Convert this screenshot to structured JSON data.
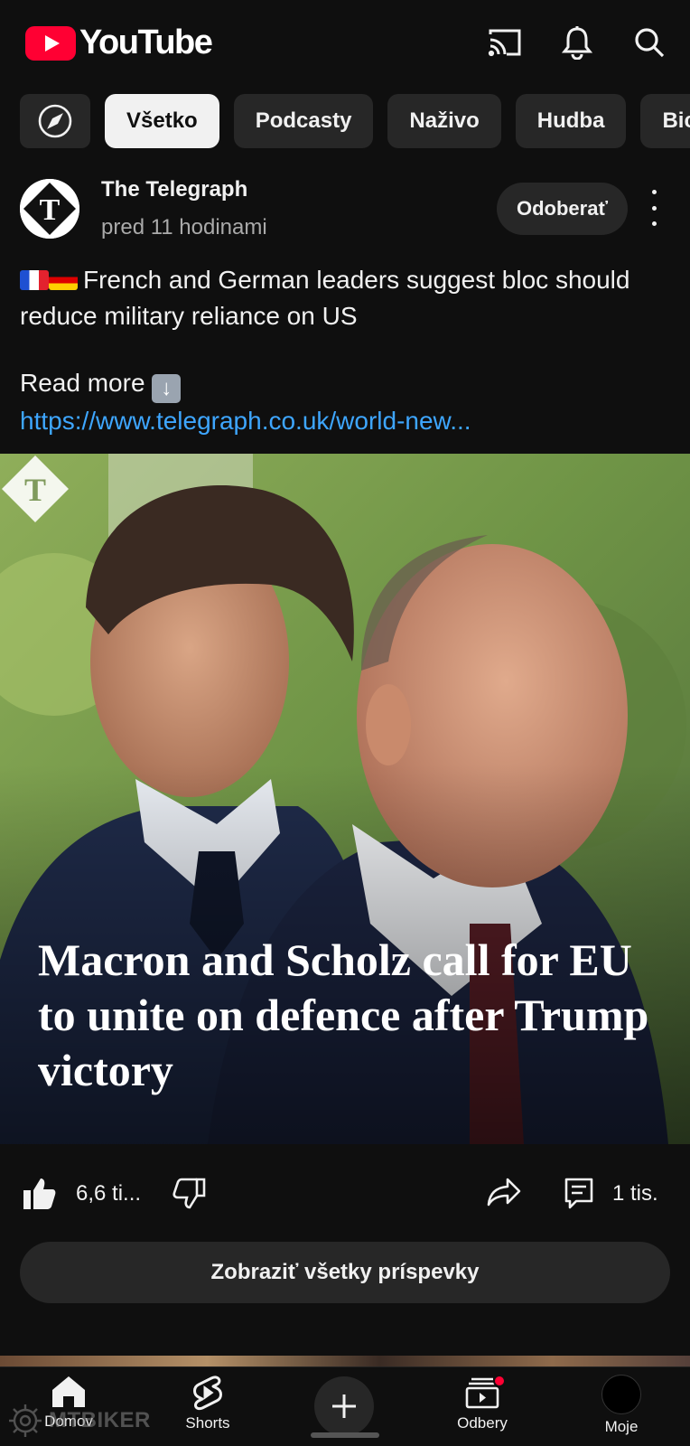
{
  "app": {
    "logo_word": "YouTube"
  },
  "header": {
    "icons": [
      "cast-icon",
      "bell-icon",
      "search-icon"
    ]
  },
  "chips": {
    "items": [
      {
        "label": "Všetko",
        "active": true
      },
      {
        "label": "Podcasty",
        "active": false
      },
      {
        "label": "Naživo",
        "active": false
      },
      {
        "label": "Hudba",
        "active": false
      },
      {
        "label": "Bicy",
        "active": false
      }
    ]
  },
  "post": {
    "channel": "The Telegraph",
    "time": "pred 11 hodinami",
    "subscribe_label": "Odoberať",
    "text_line": "French and German leaders suggest bloc should reduce military reliance on US",
    "read_more": "Read more",
    "link": "https://www.telegraph.co.uk/world-new...",
    "image_headline": "Macron and Scholz call for EU to unite on defence after Trump victory",
    "likes": "6,6 ti...",
    "comments": "1 tis.",
    "show_all_label": "Zobraziť všetky príspevky"
  },
  "bottom_nav": {
    "items": [
      {
        "label": "Domov",
        "icon": "home-icon",
        "active": true
      },
      {
        "label": "Shorts",
        "icon": "shorts-icon",
        "active": false
      },
      {
        "label": "",
        "icon": "create-icon",
        "active": false
      },
      {
        "label": "Odbery",
        "icon": "subscriptions-icon",
        "active": false
      },
      {
        "label": "Moje",
        "icon": "avatar",
        "active": false
      }
    ]
  },
  "watermark": {
    "text": "MTBIKER"
  },
  "colors": {
    "background": "#0f0f0f",
    "accent": "#ff0033",
    "link": "#3ea6ff",
    "chip": "#272727"
  }
}
